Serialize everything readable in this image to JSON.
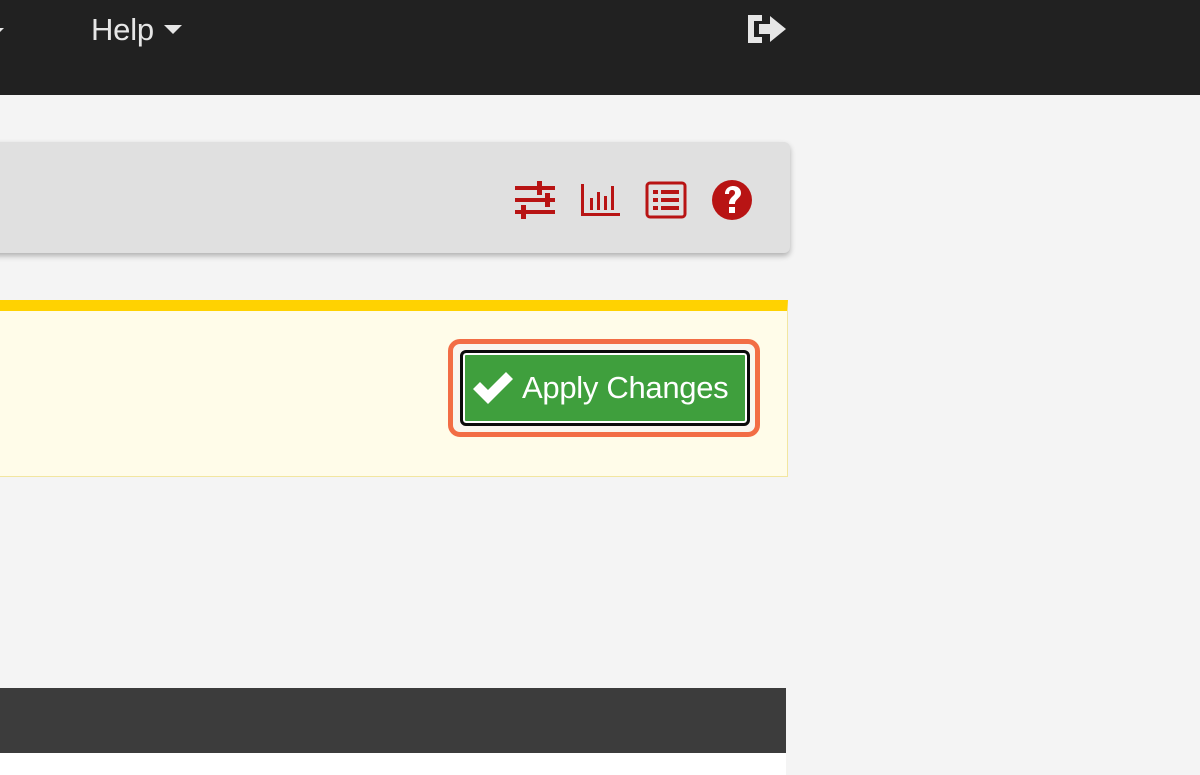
{
  "navbar": {
    "help_label": "Help"
  },
  "icons": {
    "caret": "caret-down-icon",
    "logout": "sign-out-icon",
    "sliders": "sliders-icon",
    "chart": "bar-chart-icon",
    "list": "list-icon",
    "help": "question-circle-icon",
    "check": "check-icon"
  },
  "notice": {
    "apply_label": "Apply Changes"
  },
  "colors": {
    "navbar": "#212121",
    "icon_red": "#b81414",
    "notice_border": "#ffd201",
    "notice_bg": "#fffce9",
    "apply_green": "#3f9f3d",
    "highlight": "#f26d45"
  }
}
